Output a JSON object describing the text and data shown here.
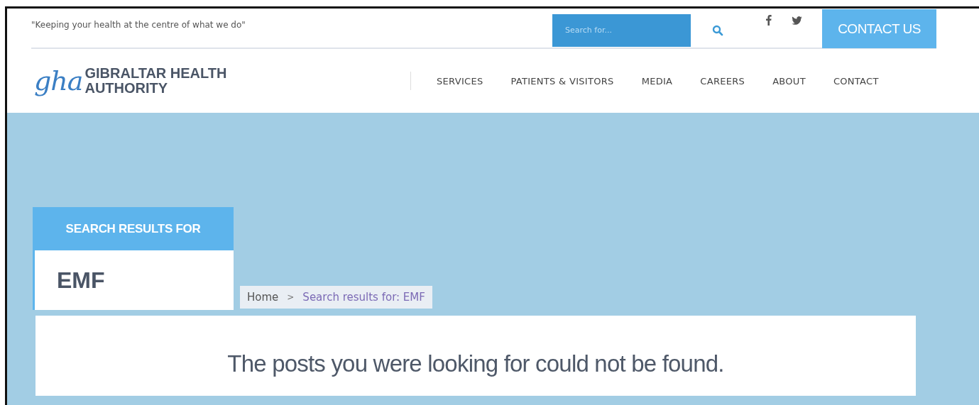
{
  "top_bar": {
    "tagline": "\"Keeping your health at the centre of what we do\"",
    "search": {
      "placeholder": "Search for..."
    },
    "contact_button": "CONTACT US"
  },
  "logo": {
    "mark": "gha",
    "name_line_1": "GIBRALTAR HEALTH",
    "name_line_2": "AUTHORITY"
  },
  "nav": [
    "SERVICES",
    "PATIENTS & VISITORS",
    "MEDIA",
    "CAREERS",
    "ABOUT",
    "CONTACT"
  ],
  "results_card": {
    "heading": "SEARCH RESULTS FOR",
    "query": "EMF"
  },
  "breadcrumb": {
    "home": "Home",
    "separator": ">",
    "current": "Search results for: EMF"
  },
  "message": "The posts you were looking for could not be found."
}
